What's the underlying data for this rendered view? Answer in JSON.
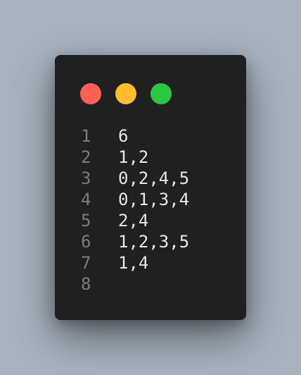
{
  "window": {
    "controls": {
      "close_color": "#ff5f56",
      "minimize_color": "#ffbd2e",
      "maximize_color": "#27c93f"
    }
  },
  "editor": {
    "lines": [
      {
        "number": "1",
        "text": "6"
      },
      {
        "number": "2",
        "text": "1,2"
      },
      {
        "number": "3",
        "text": "0,2,4,5"
      },
      {
        "number": "4",
        "text": "0,1,3,4"
      },
      {
        "number": "5",
        "text": "2,4"
      },
      {
        "number": "6",
        "text": "1,2,3,5"
      },
      {
        "number": "7",
        "text": "1,4"
      },
      {
        "number": "8",
        "text": ""
      }
    ]
  }
}
